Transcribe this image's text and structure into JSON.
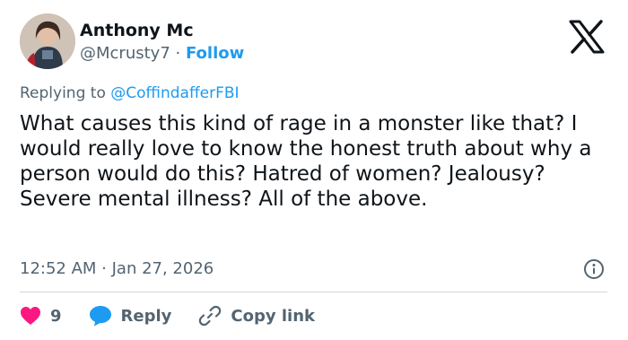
{
  "author": {
    "name": "Anthony Mc",
    "handle": "@Mcrusty7",
    "separator": "·",
    "follow_label": "Follow"
  },
  "reply_context": {
    "prefix": "Replying to ",
    "mention": "@CoffindafferFBI"
  },
  "tweet": {
    "text": "What causes this kind of rage in a monster like that? I would really love to know the honest truth about why a person would do this? Hatred of women? Jealousy? Severe mental illness? All of the above.",
    "timestamp": "12:52 AM · Jan 27, 2026"
  },
  "actions": {
    "like_count": "9",
    "reply_label": "Reply",
    "copy_label": "Copy link"
  },
  "icons": {
    "logo": "x-logo-icon",
    "info": "info-icon",
    "like": "heart-icon",
    "reply": "speech-bubble-icon",
    "copy": "link-icon"
  },
  "colors": {
    "accent": "#1d9bf0",
    "like": "#f91880",
    "text": "#0f1419",
    "muted": "#536471",
    "divider": "#cfd9de"
  }
}
